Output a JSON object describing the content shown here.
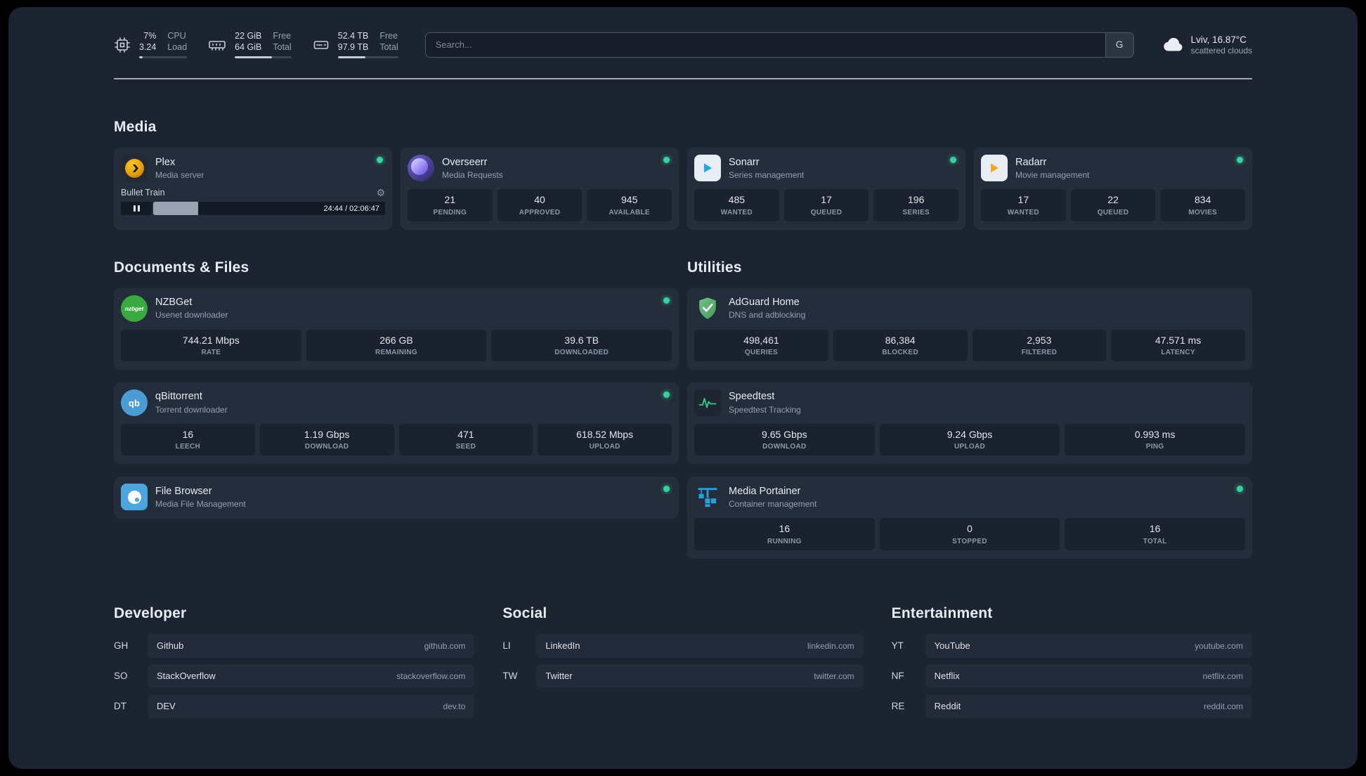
{
  "colors": {
    "bg": "#1c2431",
    "card": "#242d3b",
    "tile": "#1a2230",
    "status-green": "#34d399"
  },
  "topbar": {
    "cpu": {
      "icon": "cpu-chip-icon",
      "value_top": "7%",
      "value_bottom": "3.24",
      "label_top": "CPU",
      "label_bottom": "Load",
      "bar_percent": 7
    },
    "memory": {
      "icon": "memory-icon",
      "value_top": "22 GiB",
      "value_bottom": "64 GiB",
      "label_top": "Free",
      "label_bottom": "Total",
      "bar_percent": 66
    },
    "disk": {
      "icon": "disk-icon",
      "value_top": "52.4 TB",
      "value_bottom": "97.9 TB",
      "label_top": "Free",
      "label_bottom": "Total",
      "bar_percent": 46
    },
    "search": {
      "placeholder": "Search...",
      "button_label": "G"
    },
    "weather": {
      "icon": "cloud-icon",
      "location": "Lviv, 16.87°C",
      "condition": "scattered clouds"
    }
  },
  "groups": {
    "media": {
      "title": "Media",
      "cards": [
        {
          "icon": "plex-icon",
          "name": "Plex",
          "desc": "Media server",
          "online": true,
          "player": {
            "title": "Bullet Train",
            "time": "24:44 / 02:06:47",
            "progress_percent": 19.5
          }
        },
        {
          "icon": "overseerr-icon",
          "name": "Overseerr",
          "desc": "Media Requests",
          "online": true,
          "stats": [
            {
              "value": "21",
              "label": "PENDING"
            },
            {
              "value": "40",
              "label": "APPROVED"
            },
            {
              "value": "945",
              "label": "AVAILABLE"
            }
          ]
        },
        {
          "icon": "sonarr-icon",
          "name": "Sonarr",
          "desc": "Series management",
          "online": true,
          "stats": [
            {
              "value": "485",
              "label": "WANTED"
            },
            {
              "value": "17",
              "label": "QUEUED"
            },
            {
              "value": "196",
              "label": "SERIES"
            }
          ]
        },
        {
          "icon": "radarr-icon",
          "name": "Radarr",
          "desc": "Movie management",
          "online": true,
          "stats": [
            {
              "value": "17",
              "label": "WANTED"
            },
            {
              "value": "22",
              "label": "QUEUED"
            },
            {
              "value": "834",
              "label": "MOVIES"
            }
          ]
        }
      ]
    },
    "documents": {
      "title": "Documents & Files",
      "cards": [
        {
          "icon": "nzbget-icon",
          "name": "NZBGet",
          "desc": "Usenet downloader",
          "online": true,
          "stats": [
            {
              "value": "744.21 Mbps",
              "label": "RATE"
            },
            {
              "value": "266 GB",
              "label": "REMAINING"
            },
            {
              "value": "39.6 TB",
              "label": "DOWNLOADED"
            }
          ]
        },
        {
          "icon": "qbittorrent-icon",
          "name": "qBittorrent",
          "desc": "Torrent downloader",
          "online": true,
          "stats": [
            {
              "value": "16",
              "label": "LEECH"
            },
            {
              "value": "1.19 Gbps",
              "label": "DOWNLOAD"
            },
            {
              "value": "471",
              "label": "SEED"
            },
            {
              "value": "618.52 Mbps",
              "label": "UPLOAD"
            }
          ]
        },
        {
          "icon": "filebrowser-icon",
          "name": "File Browser",
          "desc": "Media File Management",
          "online": true,
          "stats": []
        }
      ]
    },
    "utilities": {
      "title": "Utilities",
      "cards": [
        {
          "icon": "adguard-icon",
          "name": "AdGuard Home",
          "desc": "DNS and adblocking",
          "online": false,
          "stats": [
            {
              "value": "498,461",
              "label": "QUERIES"
            },
            {
              "value": "86,384",
              "label": "BLOCKED"
            },
            {
              "value": "2,953",
              "label": "FILTERED"
            },
            {
              "value": "47.571 ms",
              "label": "LATENCY"
            }
          ]
        },
        {
          "icon": "speedtest-icon",
          "name": "Speedtest",
          "desc": "Speedtest Tracking",
          "online": false,
          "stats": [
            {
              "value": "9.65 Gbps",
              "label": "DOWNLOAD"
            },
            {
              "value": "9.24 Gbps",
              "label": "UPLOAD"
            },
            {
              "value": "0.993 ms",
              "label": "PING"
            }
          ]
        },
        {
          "icon": "portainer-icon",
          "name": "Media Portainer",
          "desc": "Container management",
          "online": true,
          "stats": [
            {
              "value": "16",
              "label": "RUNNING"
            },
            {
              "value": "0",
              "label": "STOPPED"
            },
            {
              "value": "16",
              "label": "TOTAL"
            }
          ]
        }
      ]
    }
  },
  "bookmarks": [
    {
      "title": "Developer",
      "items": [
        {
          "abbr": "GH",
          "name": "Github",
          "url": "github.com"
        },
        {
          "abbr": "SO",
          "name": "StackOverflow",
          "url": "stackoverflow.com"
        },
        {
          "abbr": "DT",
          "name": "DEV",
          "url": "dev.to"
        }
      ]
    },
    {
      "title": "Social",
      "items": [
        {
          "abbr": "LI",
          "name": "LinkedIn",
          "url": "linkedin.com"
        },
        {
          "abbr": "TW",
          "name": "Twitter",
          "url": "twitter.com"
        }
      ]
    },
    {
      "title": "Entertainment",
      "items": [
        {
          "abbr": "YT",
          "name": "YouTube",
          "url": "youtube.com"
        },
        {
          "abbr": "NF",
          "name": "Netflix",
          "url": "netflix.com"
        },
        {
          "abbr": "RE",
          "name": "Reddit",
          "url": "reddit.com"
        }
      ]
    }
  ]
}
